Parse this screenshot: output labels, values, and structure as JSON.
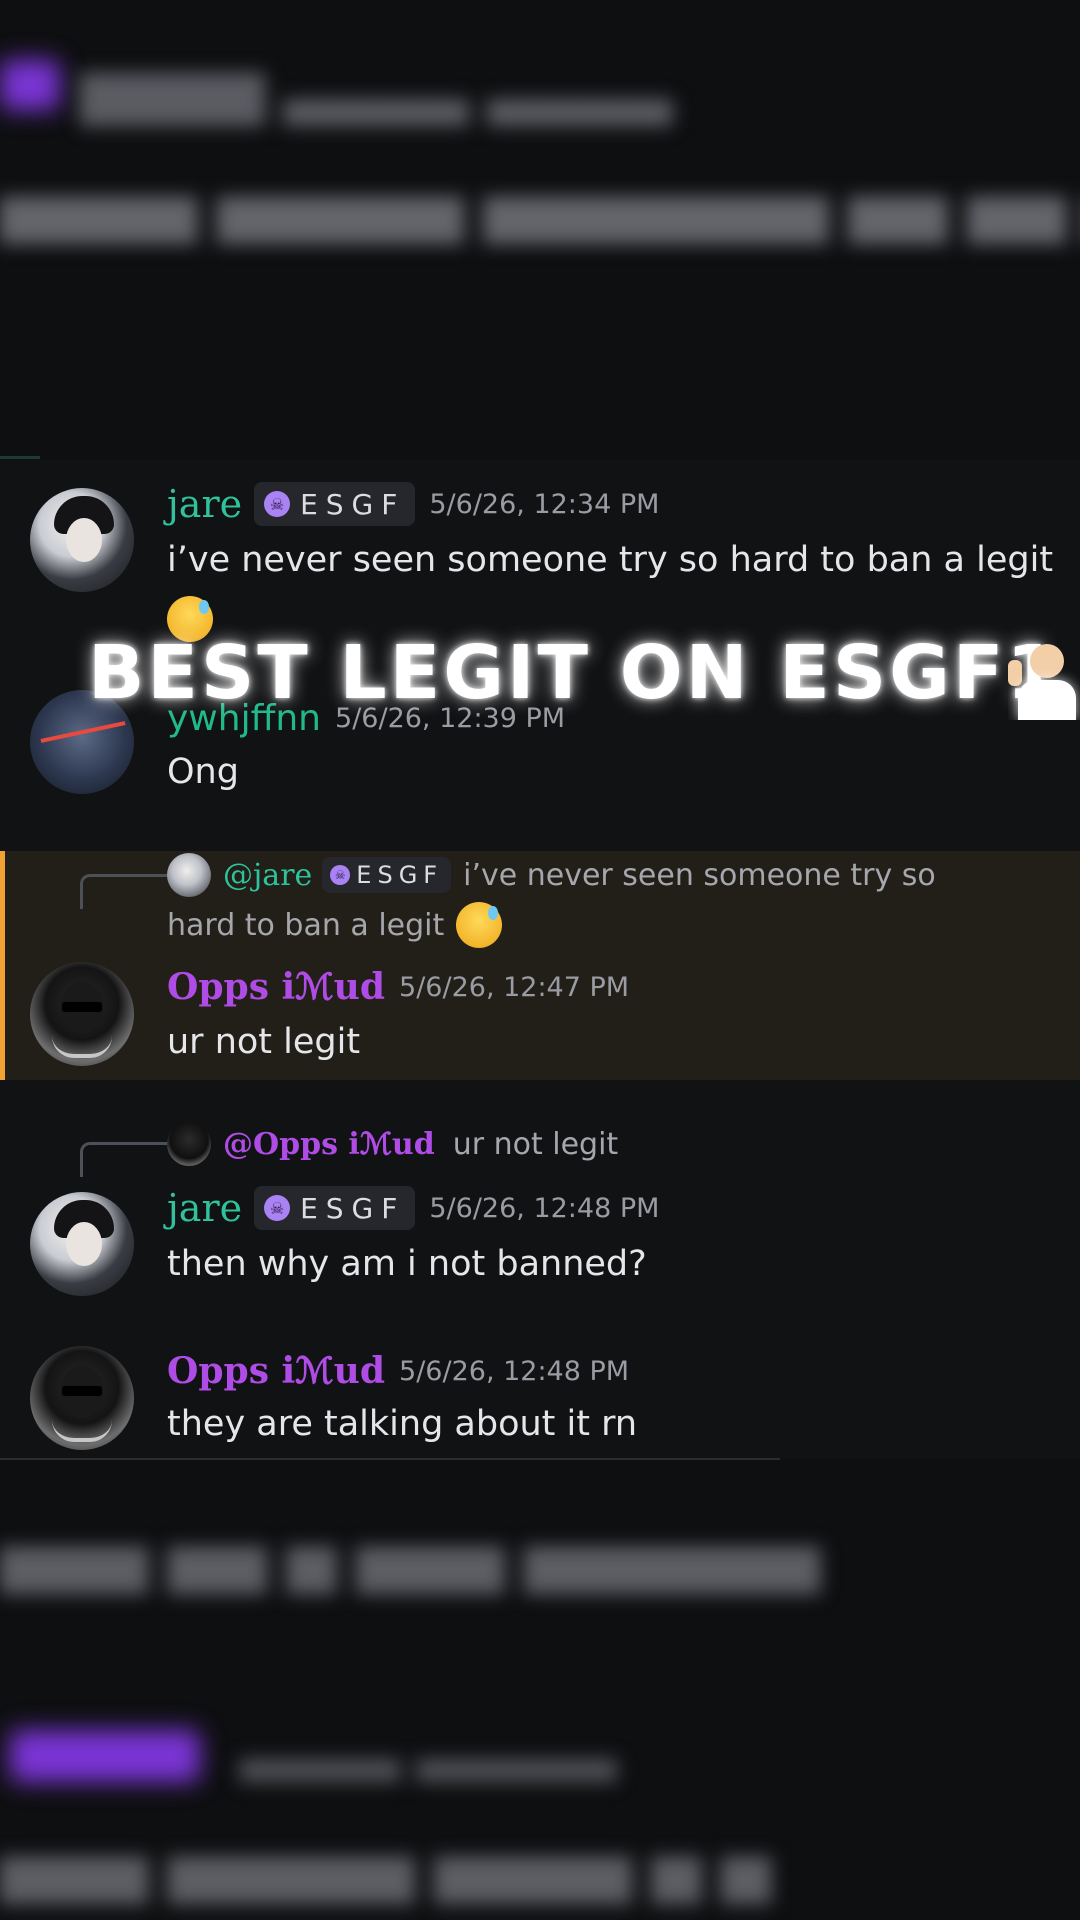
{
  "overlay_caption": "BEST LEGIT ON ESGF1",
  "messages": [
    {
      "username": "jare",
      "tag": "ESGF",
      "timestamp": "5/6/26, 12:34 PM",
      "text": "i’ve never seen someone try so hard to ban a legit"
    },
    {
      "username": "ywhjffnn",
      "timestamp": "5/6/26, 12:39 PM",
      "text": "Ong"
    },
    {
      "reply": {
        "mention": "@jare",
        "tag": "ESGF",
        "text": "i’ve never seen someone try so",
        "text_line2": "hard to ban a legit"
      },
      "username": "Opps iℳud",
      "timestamp": "5/6/26, 12:47 PM",
      "text": "ur not legit",
      "highlighted": true,
      "highlight_color": "#f0a232"
    },
    {
      "reply": {
        "mention": "@Opps iℳud",
        "text": "ur not legit"
      },
      "username": "jare",
      "tag": "ESGF",
      "timestamp": "5/6/26, 12:48 PM",
      "text": "then why am i not banned?"
    },
    {
      "username": "Opps iℳud",
      "timestamp": "5/6/26, 12:48 PM",
      "text": "they are talking about it rn"
    }
  ],
  "colors": {
    "jare": "#2fc29c",
    "ywhjffnn": "#22b98a",
    "opps": "#b04ce6",
    "tag_icon": "#a982f4"
  },
  "icons": [
    "skull-icon",
    "sweat-smile-emoji",
    "shrug-emoji"
  ]
}
